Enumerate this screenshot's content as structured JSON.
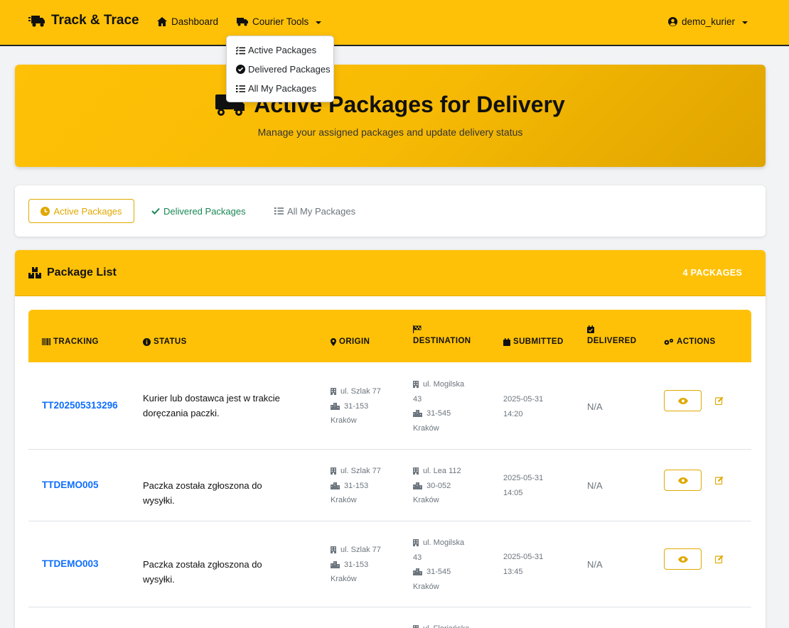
{
  "nav": {
    "brand": "Track & Trace",
    "dashboard": "Dashboard",
    "courier_tools": "Courier Tools",
    "user": "demo_kurier"
  },
  "dropdown": {
    "items": [
      {
        "label": "Active Packages",
        "icon": "list-check-icon"
      },
      {
        "label": "Delivered Packages",
        "icon": "check-circle-icon"
      },
      {
        "label": "All My Packages",
        "icon": "list-icon"
      }
    ]
  },
  "hero": {
    "title": "Active Packages for Delivery",
    "subtitle": "Manage your assigned packages and update delivery status"
  },
  "filters": {
    "active": "Active Packages",
    "delivered": "Delivered Packages",
    "all": "All My Packages"
  },
  "package_list": {
    "title": "Package List",
    "count": "4 PACKAGES",
    "headers": {
      "tracking": "TRACKING",
      "status": "STATUS",
      "origin": "ORIGIN",
      "destination": "DESTINATION",
      "submitted": "SUBMITTED",
      "delivered": "DELIVERED",
      "actions": "ACTIONS"
    },
    "rows": [
      {
        "tracking": "TT202505313296",
        "status": "Kurier lub dostawca jest w trakcie doręczania paczki.",
        "origin": {
          "street": "ul. Szlak 77",
          "postal": "31-153",
          "city": "Kraków"
        },
        "destination": {
          "street": "ul. Mogilska",
          "street2": "43",
          "postal": "31-545",
          "city": "Kraków"
        },
        "submitted_date": "2025-05-31",
        "submitted_time": "14:20",
        "delivered": "N/A"
      },
      {
        "tracking": "TTDEMO005",
        "status": "Paczka została zgłoszona do wysyłki.",
        "origin": {
          "street": "ul. Szlak 77",
          "postal": "31-153",
          "city": "Kraków"
        },
        "destination": {
          "street": "ul. Lea 112",
          "postal": "30-052",
          "city": "Kraków"
        },
        "submitted_date": "2025-05-31",
        "submitted_time": "14:05",
        "delivered": "N/A"
      },
      {
        "tracking": "TTDEMO003",
        "status": "Paczka została zgłoszona do wysyłki.",
        "origin": {
          "street": "ul. Szlak 77",
          "postal": "31-153",
          "city": "Kraków"
        },
        "destination": {
          "street": "ul. Mogilska",
          "street2": "43",
          "postal": "31-545",
          "city": "Kraków"
        },
        "submitted_date": "2025-05-31",
        "submitted_time": "13:45",
        "delivered": "N/A"
      }
    ],
    "row4_partial": {
      "destination_street": "ul. Floriańska"
    }
  },
  "colors": {
    "primary": "#ffc107",
    "link": "#0d6efd",
    "success": "#198754",
    "muted": "#6c757d"
  }
}
